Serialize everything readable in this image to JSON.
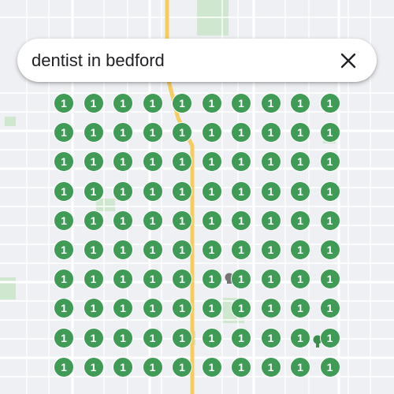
{
  "search": {
    "value": "dentist in bedford",
    "clear_icon": "close-icon"
  },
  "map": {
    "colors": {
      "background": "#eef0f3",
      "street": "#ffffff",
      "highway": "#f5cc60",
      "park": "#cfe6cf",
      "poi": "#757575",
      "dental_poi": "#3c8c4e"
    }
  },
  "results": {
    "pin_color": "#3f9b56",
    "rows": [
      [
        "1",
        "1",
        "1",
        "1",
        "1",
        "1",
        "1",
        "1",
        "1",
        "1"
      ],
      [
        "1",
        "1",
        "1",
        "1",
        "1",
        "1",
        "1",
        "1",
        "1",
        "1"
      ],
      [
        "1",
        "1",
        "1",
        "1",
        "1",
        "1",
        "1",
        "1",
        "1",
        "1"
      ],
      [
        "1",
        "1",
        "1",
        "1",
        "1",
        "1",
        "1",
        "1",
        "1",
        "1"
      ],
      [
        "1",
        "1",
        "1",
        "1",
        "1",
        "1",
        "1",
        "1",
        "1",
        "1"
      ],
      [
        "1",
        "1",
        "1",
        "1",
        "1",
        "1",
        "1",
        "1",
        "1",
        "1"
      ],
      [
        "1",
        "1",
        "1",
        "1",
        "1",
        "1",
        "1",
        "1",
        "1",
        "1"
      ],
      [
        "1",
        "1",
        "1",
        "1",
        "1",
        "1",
        "1",
        "1",
        "1",
        "1"
      ],
      [
        "1",
        "1",
        "1",
        "1",
        "1",
        "1",
        "1",
        "1",
        "1",
        "1"
      ],
      [
        "1",
        "1",
        "1",
        "1",
        "1",
        "1",
        "1",
        "1",
        "1",
        "1"
      ]
    ]
  }
}
